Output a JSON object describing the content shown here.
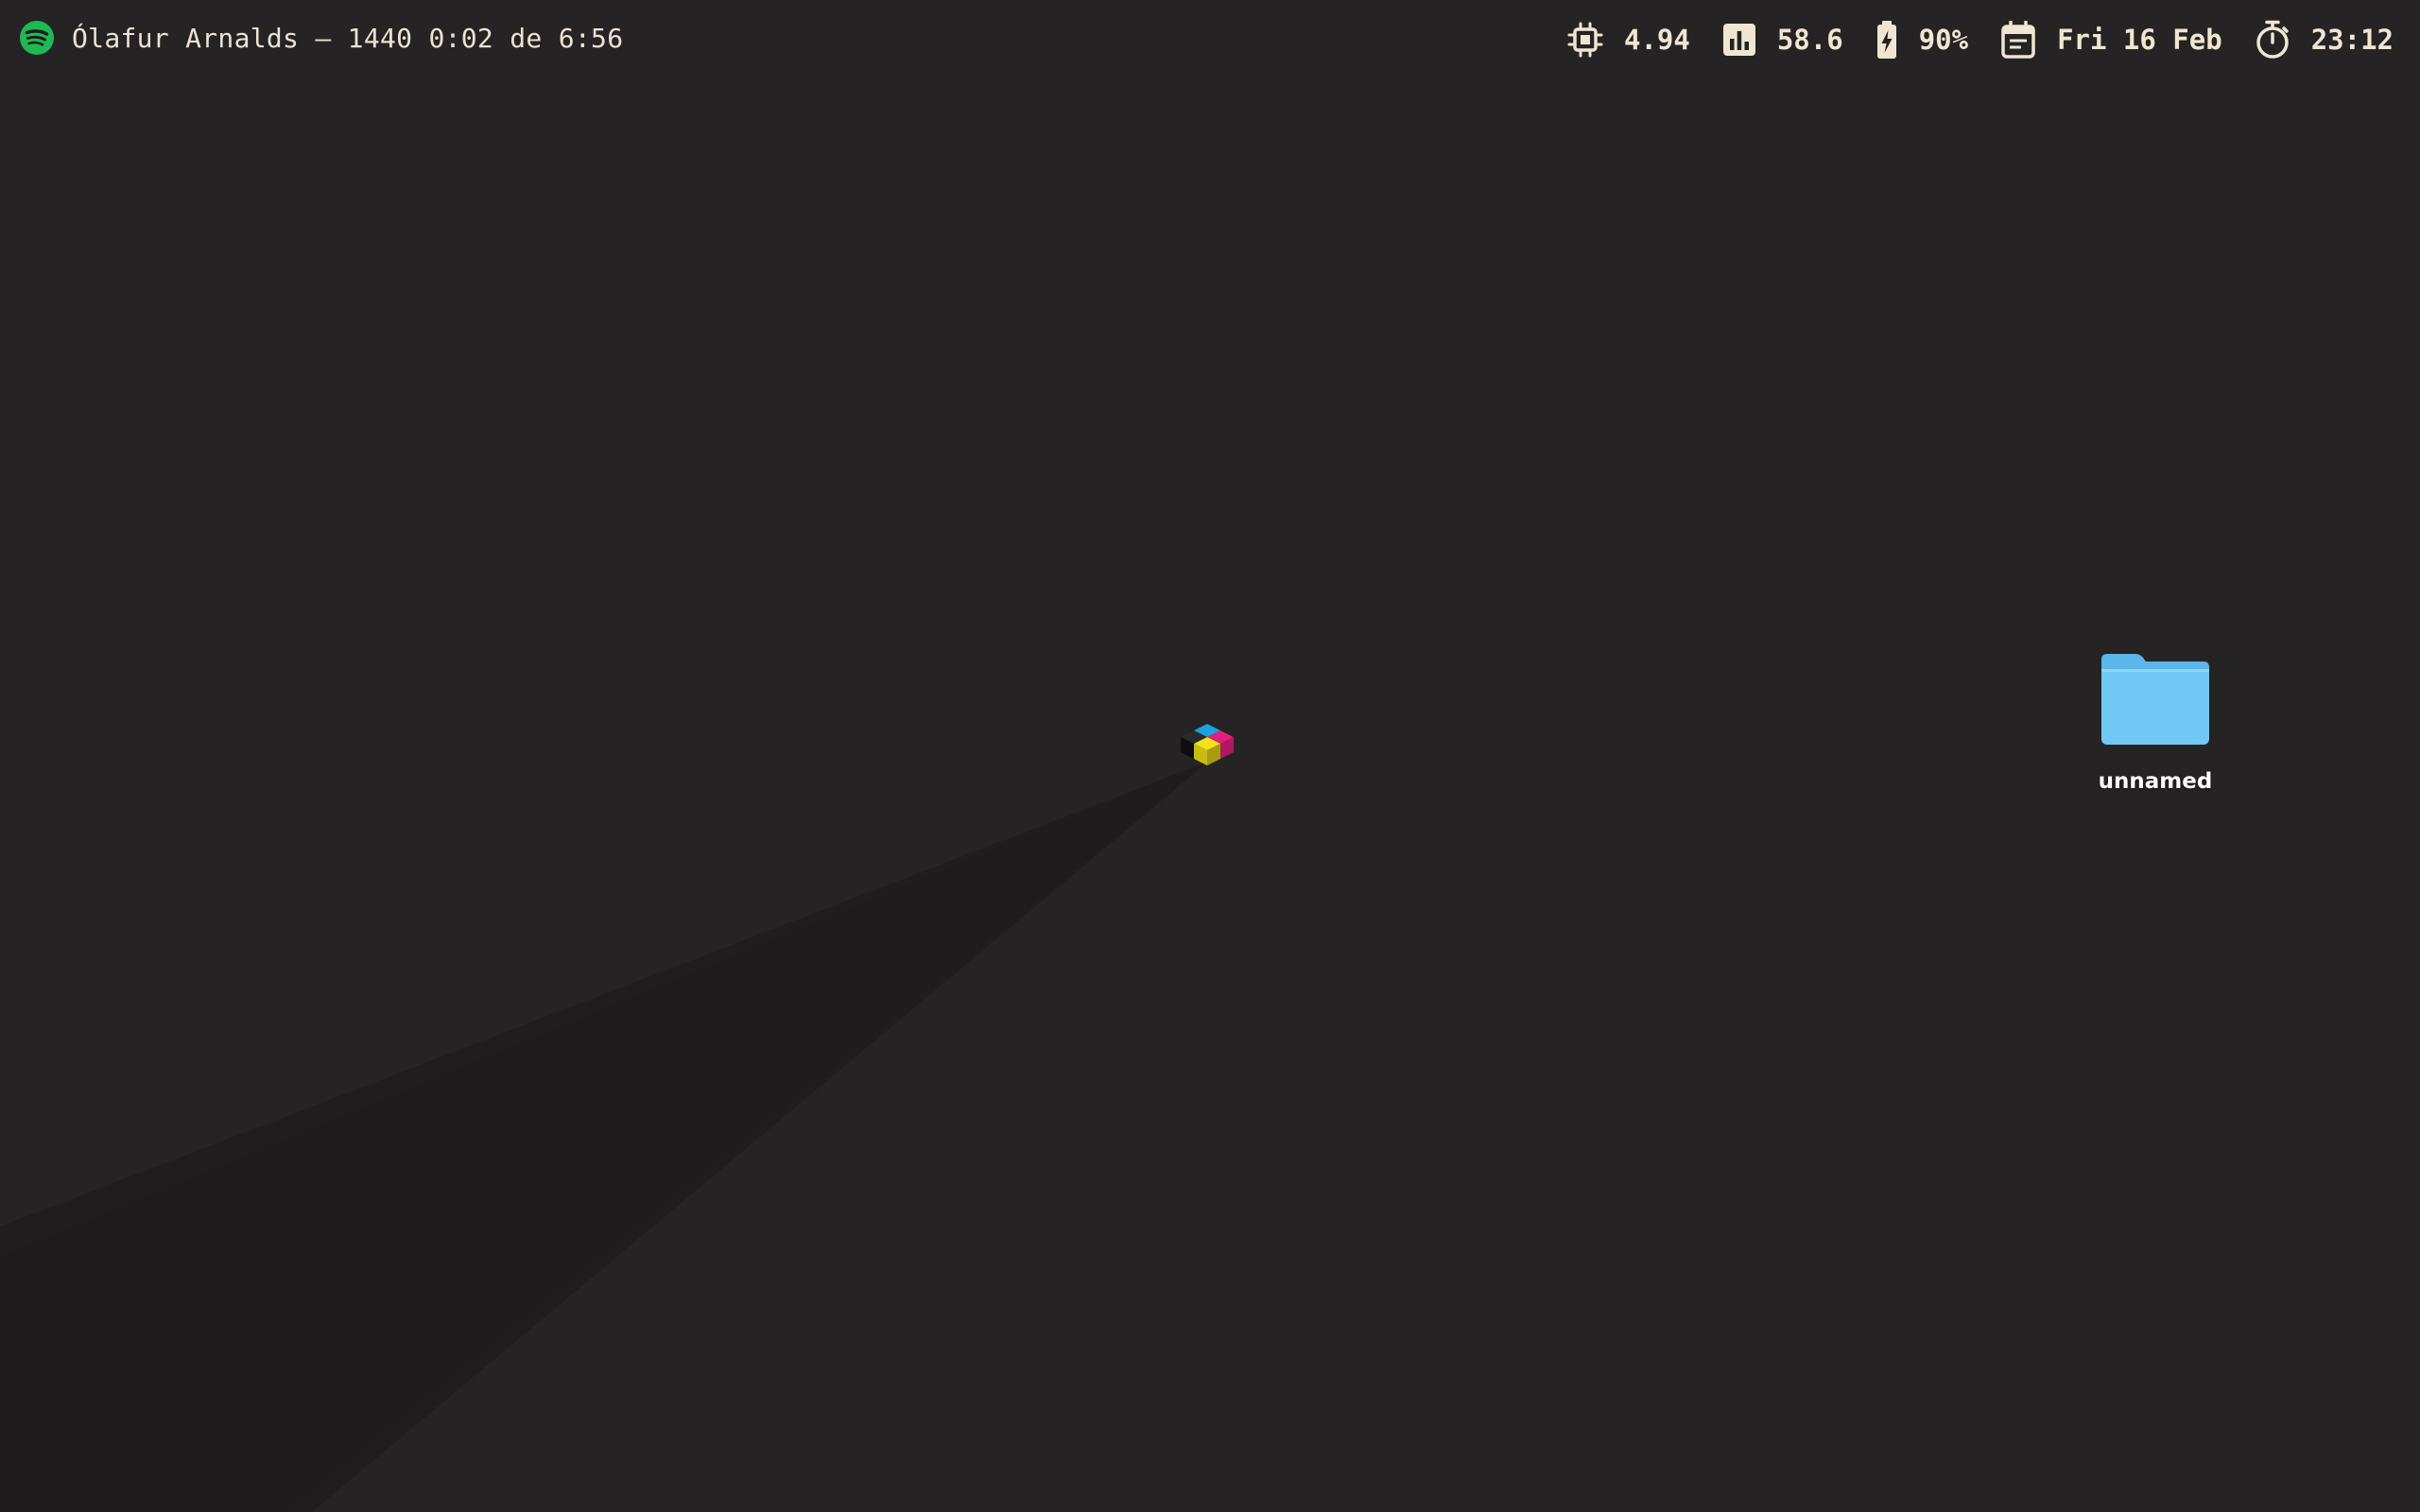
{
  "menubar": {
    "left": {
      "icon": "spotify-icon",
      "now_playing": "Ólafur Arnalds – 1440 0:02 de 6:56"
    },
    "widgets": [
      {
        "name": "cpu",
        "icon": "cpu-icon",
        "value": "4.94"
      },
      {
        "name": "stats",
        "icon": "bar-chart-icon",
        "value": "58.6"
      },
      {
        "name": "battery",
        "icon": "battery-charging-icon",
        "value": "90%"
      },
      {
        "name": "date",
        "icon": "calendar-icon",
        "value": "Fri 16 Feb"
      },
      {
        "name": "time",
        "icon": "stopwatch-icon",
        "value": "23:12"
      }
    ]
  },
  "desktop": {
    "folder": {
      "icon": "folder-icon",
      "label": "unnamed"
    },
    "center_logo": "cmyk-cube-icon"
  },
  "colors": {
    "background": "#252324",
    "text": "#efe6d2",
    "spotify_green": "#1db954",
    "folder_blue": "#6cc4f5",
    "cyan": "#1aa3e0",
    "magenta": "#e0207e",
    "yellow": "#f2e21b",
    "black": "#111111"
  }
}
